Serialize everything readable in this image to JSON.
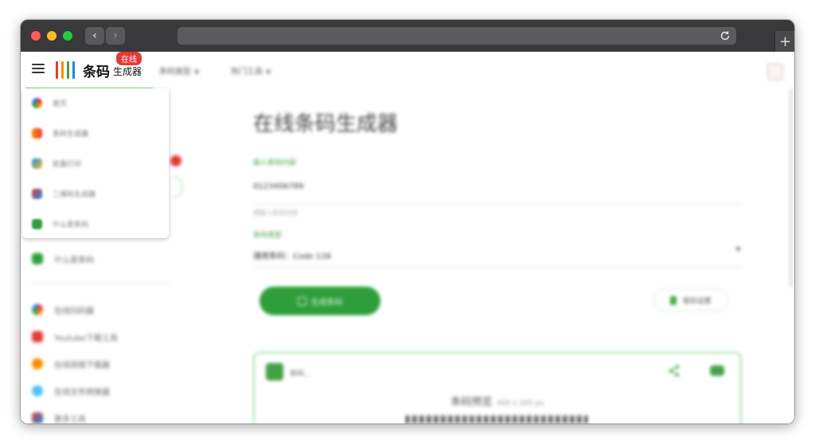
{
  "colors": {
    "brand_green": "#2e9e3b",
    "badge_red": "#e53935",
    "titlebar": "#39393b"
  },
  "browser": {
    "back_glyph": "‹",
    "forward_glyph": "›",
    "new_tab_glyph": "+"
  },
  "header": {
    "logo_text": "条码",
    "logo_sub": "生成器",
    "badge": "在线",
    "nav": [
      {
        "label": "条码类型"
      },
      {
        "label": "热门工具"
      }
    ]
  },
  "dropdown_menu": {
    "items": [
      {
        "label": "首页",
        "icon": "google-color-icon"
      },
      {
        "label": "条码生成器",
        "icon": "barcode-color-icon"
      },
      {
        "label": "批量打印",
        "icon": "grid-color-icon"
      },
      {
        "label": "二维码生成器",
        "icon": "qr-color-icon"
      },
      {
        "label": "什么是条码",
        "icon": "leaf-green-icon"
      }
    ]
  },
  "sidebar": {
    "items": [
      {
        "label": "什么是条码",
        "icon": "leaf-green-icon"
      },
      {
        "label": "在线扫码器",
        "icon": "google-color-icon"
      },
      {
        "label": "Youtube下载工具",
        "icon": "youtube-red-icon"
      },
      {
        "label": "在线视频下载器",
        "icon": "orange-circle-icon"
      },
      {
        "label": "在线文件转换器",
        "icon": "globe-blue-icon"
      },
      {
        "label": "更多工具",
        "icon": "multi-color-icon"
      }
    ]
  },
  "main": {
    "title": "在线条码生成器",
    "input_label": "输入条码内容",
    "input_value": "0123456789",
    "input_hint": "请输入条码内容",
    "type_label": "条码类型",
    "type_value": "通用条码：Code 128",
    "generate_button": "生成条码",
    "secondary_button": "保存设置"
  },
  "result": {
    "status": "条码...",
    "title": "条码预览",
    "title_meta": "400 x 200 px"
  }
}
